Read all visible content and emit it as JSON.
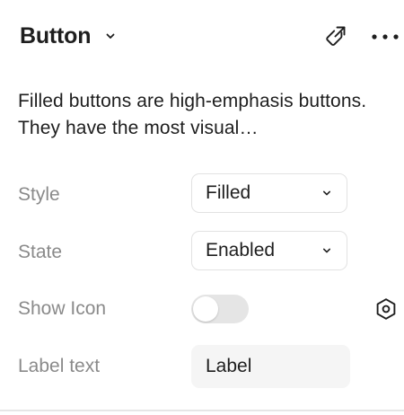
{
  "header": {
    "title": "Button",
    "title_chevron_icon": "chevron-down-icon",
    "link_icon": "go-to-main-component-icon",
    "more_icon": "more-horizontal-icon"
  },
  "description": "Filled buttons are high-emphasis buttons. They have the most visual…",
  "properties": {
    "style": {
      "label": "Style",
      "value": "Filled"
    },
    "state": {
      "label": "State",
      "value": "Enabled"
    },
    "show_icon": {
      "label": "Show Icon",
      "enabled": false,
      "instance_icon": "component-instance-icon"
    },
    "label_text": {
      "label": "Label text",
      "value": "Label"
    }
  },
  "colors": {
    "text": "#1e1e1e",
    "label": "#8a8a8a",
    "border": "#e2e2e2",
    "toggle_off": "#e5e5e5",
    "input_bg": "#f5f5f5"
  }
}
